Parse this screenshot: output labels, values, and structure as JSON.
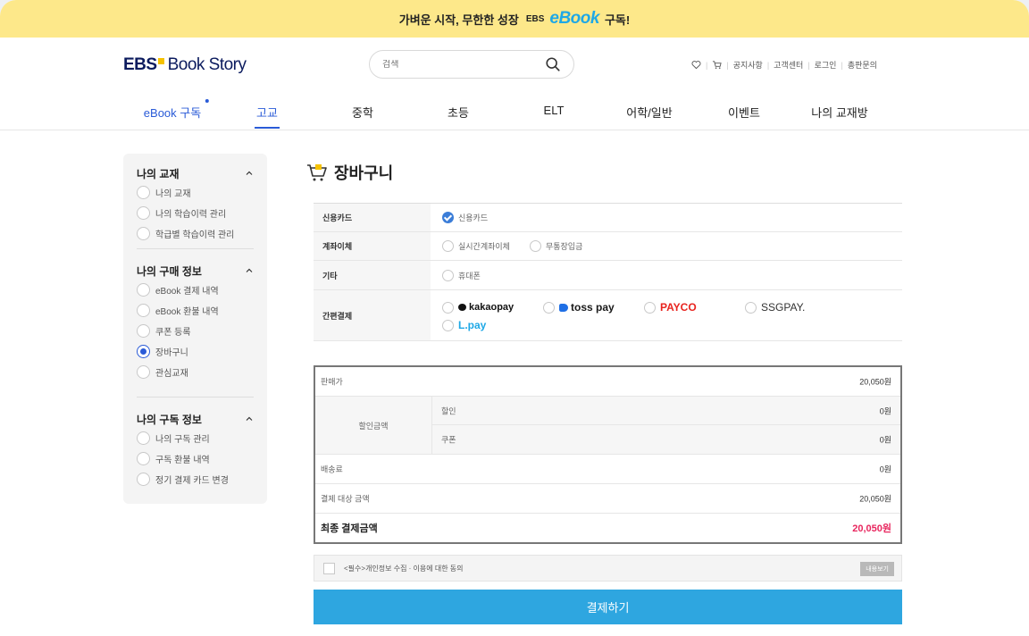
{
  "banner": {
    "text": "가벼운 시작, 무한한 성장",
    "ebs": "EBS",
    "ebook": "eBook",
    "suffix": "구독!"
  },
  "header": {
    "logo_ebs": "EBS",
    "logo_bookstory": "Book Story",
    "search_placeholder": "검색",
    "util": [
      "공지사항",
      "고객센터",
      "로그인",
      "총판문의"
    ]
  },
  "nav": [
    "eBook 구독",
    "고교",
    "중학",
    "초등",
    "ELT",
    "어학/일반",
    "이벤트",
    "나의 교재방"
  ],
  "sidebar": {
    "sections": [
      {
        "title": "나의 교재",
        "items": [
          "나의 교재",
          "나의 학습이력 관리",
          "학급별 학습이력 관리"
        ]
      },
      {
        "title": "나의 구매 정보",
        "items": [
          "eBook 결제 내역",
          "eBook 환불 내역",
          "쿠폰 등록",
          "장바구니",
          "관심교재"
        ]
      },
      {
        "title": "나의 구독 정보",
        "items": [
          "나의 구독 관리",
          "구독 환불 내역",
          "정기 결제 카드 변경"
        ]
      }
    ],
    "selected": "장바구니"
  },
  "page_title": "장바구니",
  "payment": {
    "rows": [
      {
        "label": "신용카드",
        "options": [
          "신용카드"
        ]
      },
      {
        "label": "계좌이체",
        "options": [
          "실시간계좌이체",
          "무통장입금"
        ]
      },
      {
        "label": "기타",
        "options": [
          "휴대폰"
        ]
      },
      {
        "label": "간편결제",
        "options": [
          "kakaopay",
          "toss pay",
          "PAYCO",
          "SSGPAY.",
          "L.pay"
        ]
      }
    ],
    "selected": "신용카드"
  },
  "summary": {
    "sale_price_label": "판매가",
    "sale_price": "20,050원",
    "discount_label": "할인금액",
    "discount_label2": "할인",
    "discount": "0원",
    "coupon_label": "쿠폰",
    "coupon": "0원",
    "shipping_label": "배송료",
    "shipping": "0원",
    "target_label": "결제 대상 금액",
    "target": "20,050원",
    "final_label": "최종 결제금액",
    "final": "20,050원"
  },
  "agreement": {
    "text": "<필수>개인정보 수집 · 이용에 대한 동의",
    "view_label": "내용보기"
  },
  "pay_button": "결제하기"
}
